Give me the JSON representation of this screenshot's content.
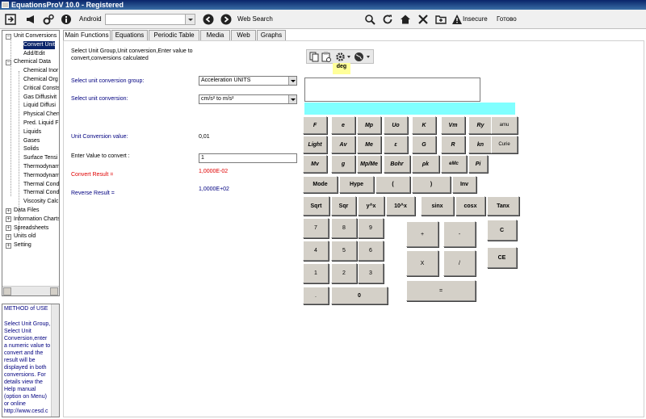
{
  "window": {
    "title": "EquationsProV 10.0 - Registered"
  },
  "toolbar": {
    "android_label": "Android",
    "web_search_label": "Web Search",
    "insecure_label": "Insecure",
    "ready_label": "Готово"
  },
  "tree": {
    "items": [
      {
        "label": "Unit Conversions",
        "level": 0,
        "expander": "−"
      },
      {
        "label": "Convert Unit",
        "level": 1,
        "selected": true
      },
      {
        "label": "Add/Edit",
        "level": 1
      },
      {
        "label": "Chemical Data",
        "level": 0,
        "expander": "−"
      },
      {
        "label": "Chemical Inor",
        "level": 1
      },
      {
        "label": "Chemical Org",
        "level": 1
      },
      {
        "label": "Critical Consts",
        "level": 1
      },
      {
        "label": "Gas Diffusivit",
        "level": 1
      },
      {
        "label": "Liquid Diffusi",
        "level": 1
      },
      {
        "label": "Physical Chen",
        "level": 1
      },
      {
        "label": "Pred. Liquid F",
        "level": 1
      },
      {
        "label": "Liquids",
        "level": 1
      },
      {
        "label": "Gases",
        "level": 1
      },
      {
        "label": "Solids",
        "level": 1
      },
      {
        "label": "Surface Tensi",
        "level": 1
      },
      {
        "label": "Thermodynam",
        "level": 1
      },
      {
        "label": "Thermodynam",
        "level": 1
      },
      {
        "label": "Thermal Cond",
        "level": 1
      },
      {
        "label": "Thermal Cond",
        "level": 1
      },
      {
        "label": "Viscosity Calc",
        "level": 1
      },
      {
        "label": "Data Files",
        "level": 0,
        "expander": "+"
      },
      {
        "label": "Information Charts",
        "level": 0,
        "expander": "+"
      },
      {
        "label": "Spreadsheets",
        "level": 0,
        "expander": "+"
      },
      {
        "label": "Units old",
        "level": 0,
        "expander": "+"
      },
      {
        "label": "Setting",
        "level": 0,
        "expander": "+"
      }
    ]
  },
  "method": {
    "title": "METHOD of USE",
    "text": "Select Unit Group, Select Unit Conversion,enter a numeric value to convert and the result will be displayed in both conversions. For details view the Help manual (option on Menu) or online http://www.cesd.c"
  },
  "tabs": [
    {
      "label": "Main Functions",
      "active": true
    },
    {
      "label": "Equations"
    },
    {
      "label": "Periodic Table"
    },
    {
      "label": "Media"
    },
    {
      "label": "Web"
    },
    {
      "label": "Graphs"
    }
  ],
  "form": {
    "instructions_line1": "Select Unit Group,Unit conversion,Enter value to",
    "instructions_line2": "convert,conversions calculated",
    "group_label": "Select unit conversion group:",
    "group_value": "Acceleration UNITS",
    "conversion_label": "Select unit conversion:",
    "conversion_value": "cm/s² to  m/s²",
    "unit_value_label": "Unit Conversion value:",
    "unit_value": "0,01",
    "enter_label": "Enter Value to convert :",
    "enter_value": "1",
    "convert_result_label": "Convert Result =",
    "convert_result": "1,0000E-02",
    "reverse_result_label": "Reverse Result =",
    "reverse_result": "1,0000E+02"
  },
  "calculator": {
    "mode_label": "deg",
    "constants_row1": [
      "F",
      "e",
      "Mp",
      "Uo",
      "K",
      "Vm",
      "Ry",
      "amu"
    ],
    "constants_row2": [
      "Light",
      "Av",
      "Me",
      "ε",
      "G",
      "R",
      "kn",
      "Curie"
    ],
    "constants_row3": [
      "Mv",
      "g",
      "Mp/Me",
      "Bohr",
      "ρk",
      "eMc",
      "Pi"
    ],
    "func_row1": [
      "Mode",
      "Hype",
      "(",
      ")",
      "Inv"
    ],
    "func_row2": [
      "Sqrt",
      "Sqr",
      "y^x",
      "10^x",
      "sinx",
      "cosx",
      "Tanx"
    ],
    "digits": [
      "7",
      "8",
      "9",
      "4",
      "5",
      "6",
      "1",
      "2",
      "3",
      ".",
      "0"
    ],
    "ops": [
      "+",
      "-",
      "X",
      "/",
      "="
    ],
    "clear": [
      "C",
      "CE"
    ]
  }
}
